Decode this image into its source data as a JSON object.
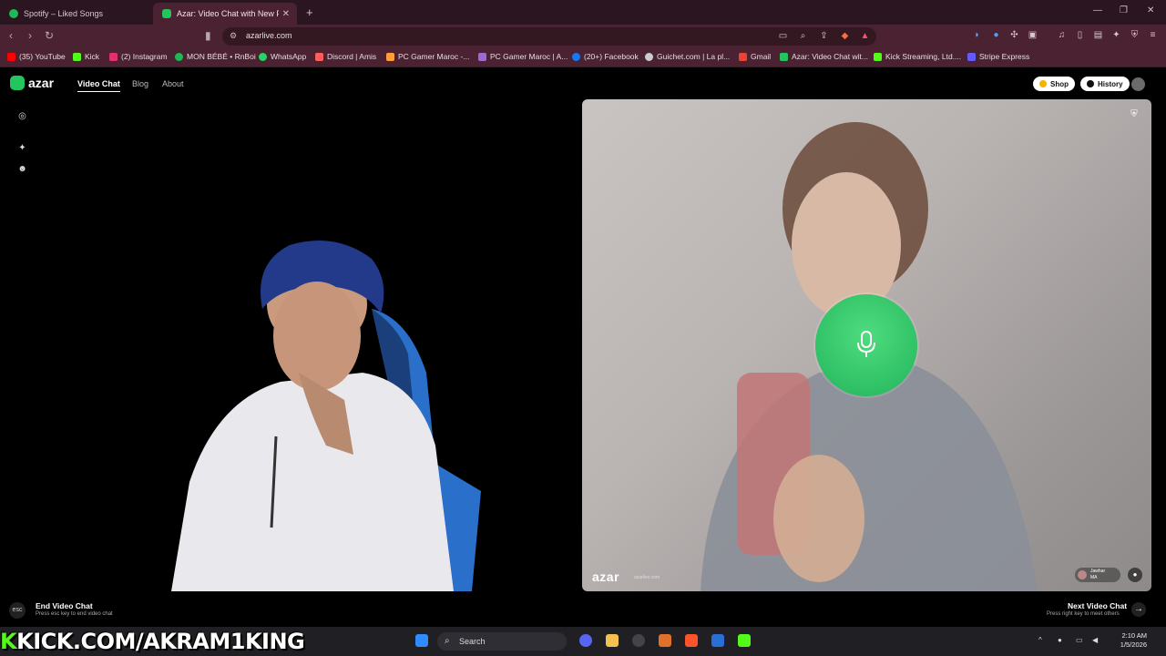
{
  "browser": {
    "tabs": [
      {
        "title": "Spotify – Liked Songs",
        "active": false
      },
      {
        "title": "Azar: Video Chat with New Pe",
        "active": true
      }
    ],
    "new_tab_glyph": "+",
    "address": "azarlive.com",
    "bookmarks": [
      {
        "label": "(35) YouTube",
        "icon_color": "#ff0000"
      },
      {
        "label": "Kick",
        "icon_color": "#53fc18"
      },
      {
        "label": "(2) Instagram",
        "icon_color": "#e1306c"
      },
      {
        "label": "MON BÉBÉ • RnBoi",
        "icon_color": "#1db954"
      },
      {
        "label": "WhatsApp",
        "icon_color": "#25d366"
      },
      {
        "label": "Discord | Amis",
        "icon_color": "#ff5c5c"
      },
      {
        "label": "PC Gamer Maroc -...",
        "icon_color": "#ff9d3b"
      },
      {
        "label": "PC Gamer Maroc | A...",
        "icon_color": "#9b6bd1"
      },
      {
        "label": "(20+) Facebook",
        "icon_color": "#1877f2"
      },
      {
        "label": "Guichet.com | La pl...",
        "icon_color": "#cccccc"
      },
      {
        "label": "Gmail",
        "icon_color": "#ea4335"
      },
      {
        "label": "Azar: Video Chat wit...",
        "icon_color": "#22c55e"
      },
      {
        "label": "Kick Streaming, Ltd....",
        "icon_color": "#53fc18"
      },
      {
        "label": "Stripe Express",
        "icon_color": "#635bff"
      }
    ]
  },
  "azar": {
    "logo_text": "azar",
    "nav": [
      "Video Chat",
      "Blog",
      "About"
    ],
    "shop_label": "Shop",
    "history_label": "History",
    "watermark": "azar",
    "watermark_sub": "azarlive.com",
    "peer_name": "Jawhar",
    "peer_country": "MA",
    "footer": {
      "esc_key": "esc",
      "end_title": "End Video Chat",
      "end_hint": "Press esc key to end video chat",
      "next_title": "Next Video Chat",
      "next_hint": "Press right key to meet others"
    },
    "colors": {
      "accent": "#22c55e",
      "mic": "#2fc56a"
    }
  },
  "overlay": {
    "kick_url_prefix": "K",
    "kick_url_rest": "KICK.COM/AKRAM1KING"
  },
  "taskbar": {
    "search_placeholder": "Search",
    "time": "2:10 AM",
    "date": "1/5/2026"
  }
}
